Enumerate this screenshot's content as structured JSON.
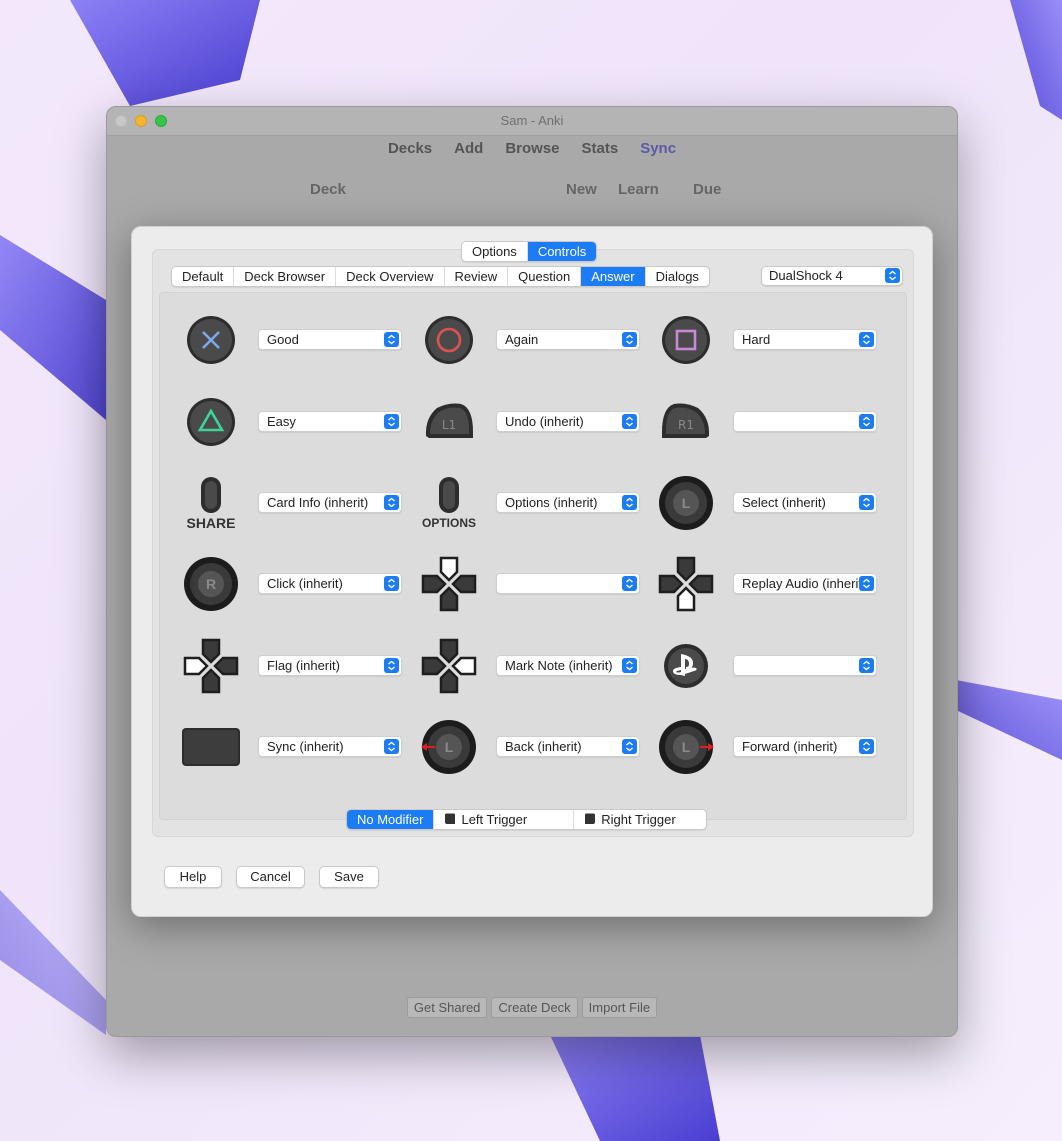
{
  "window": {
    "title": "Sam - Anki",
    "toolbar": [
      "Decks",
      "Add",
      "Browse",
      "Stats",
      "Sync"
    ],
    "deck_columns": [
      "Deck",
      "New",
      "Learn",
      "Due"
    ],
    "bottom_buttons": [
      "Get Shared",
      "Create Deck",
      "Import File"
    ]
  },
  "dialog": {
    "top_tabs": [
      "Options",
      "Controls"
    ],
    "context_tabs": [
      "Default",
      "Deck Browser",
      "Deck Overview",
      "Review",
      "Question",
      "Answer",
      "Dialogs"
    ],
    "device": "DualShock 4",
    "mappings": [
      {
        "control": "cross-button-icon",
        "action": "Good"
      },
      {
        "control": "circle-button-icon",
        "action": "Again"
      },
      {
        "control": "square-button-icon",
        "action": "Hard"
      },
      {
        "control": "triangle-button-icon",
        "action": "Easy"
      },
      {
        "control": "l1-button-icon",
        "action": "Undo (inherit)"
      },
      {
        "control": "r1-button-icon",
        "action": ""
      },
      {
        "control": "share-button-icon",
        "action": "Card Info (inherit)"
      },
      {
        "control": "options-button-icon",
        "action": "Options (inherit)"
      },
      {
        "control": "left-stick-icon",
        "action": "Select (inherit)"
      },
      {
        "control": "right-stick-icon",
        "action": "Click (inherit)"
      },
      {
        "control": "dpad-up-icon",
        "action": ""
      },
      {
        "control": "dpad-down-icon",
        "action": "Replay Audio (inherit)"
      },
      {
        "control": "dpad-left-icon",
        "action": "Flag (inherit)"
      },
      {
        "control": "dpad-right-icon",
        "action": "Mark Note (inherit)"
      },
      {
        "control": "ps-button-icon",
        "action": ""
      },
      {
        "control": "touchpad-icon",
        "action": "Sync (inherit)"
      },
      {
        "control": "left-stick-left-icon",
        "action": "Back (inherit)"
      },
      {
        "control": "left-stick-right-icon",
        "action": "Forward (inherit)"
      }
    ],
    "modifiers": [
      "No Modifier",
      "Left Trigger",
      "Right Trigger"
    ],
    "buttons": {
      "help": "Help",
      "cancel": "Cancel",
      "save": "Save"
    },
    "colors": {
      "accent": "#1b7cf5",
      "cross": "#7fa9e8",
      "circle": "#e05252",
      "square": "#c88ad6",
      "triangle": "#3fd39a"
    }
  }
}
